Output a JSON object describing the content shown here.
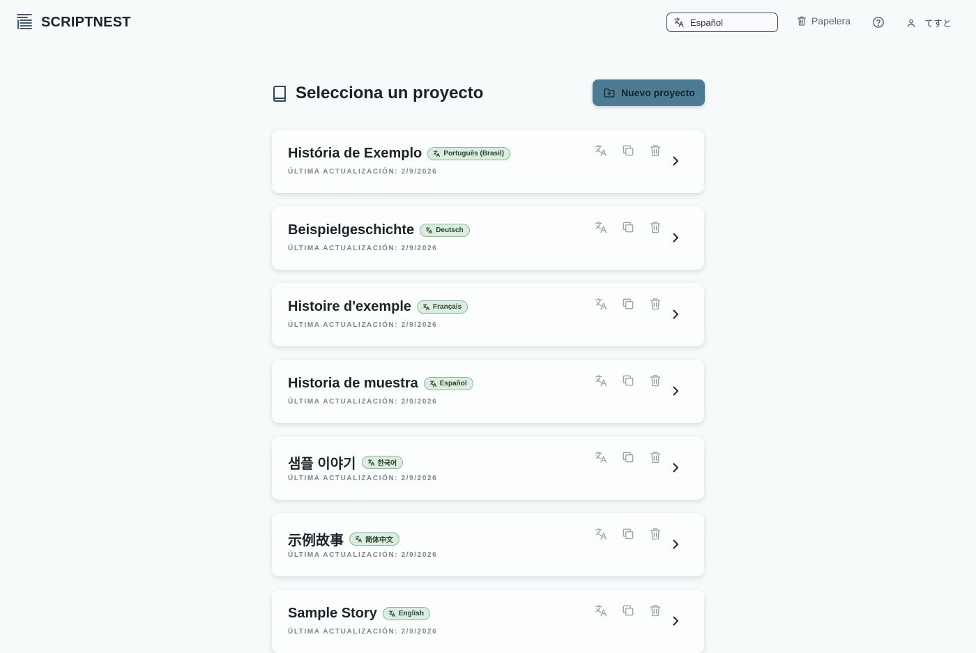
{
  "header": {
    "logo_text": "SCRIPTNEST",
    "language_value": "Español",
    "trash_label": "Papelera",
    "user_name": "てすと"
  },
  "main": {
    "title": "Selecciona un proyecto",
    "new_project_label": "Nuevo proyecto"
  },
  "projects": [
    {
      "name": "História de Exemplo",
      "language": "Português (Brasil)",
      "updated": "ÚLTIMA ACTUALIZACIÓN: 2/9/2026"
    },
    {
      "name": "Beispielgeschichte",
      "language": "Deutsch",
      "updated": "ÚLTIMA ACTUALIZACIÓN: 2/9/2026"
    },
    {
      "name": "Histoire d'exemple",
      "language": "Français",
      "updated": "ÚLTIMA ACTUALIZACIÓN: 2/9/2026"
    },
    {
      "name": "Historia de muestra",
      "language": "Español",
      "updated": "ÚLTIMA ACTUALIZACIÓN: 2/9/2026"
    },
    {
      "name": "샘플 이야기",
      "language": "한국어",
      "updated": "ÚLTIMA ACTUALIZACIÓN: 2/9/2026"
    },
    {
      "name": "示例故事",
      "language": "简体中文",
      "updated": "ÚLTIMA ACTUALIZACIÓN: 2/9/2026"
    },
    {
      "name": "Sample Story",
      "language": "English",
      "updated": "ÚLTIMA ACTUALIZACIÓN: 2/9/2026"
    }
  ],
  "icons": {
    "logo": "list-lines-icon",
    "language": "translate-icon",
    "trash": "trash-icon",
    "help": "help-circle-icon",
    "user": "user-icon",
    "book": "book-icon",
    "new_project": "folder-plus-icon",
    "duplicate": "copy-icon",
    "open": "chevron-right-icon"
  },
  "colors": {
    "primary_button": "#4c7b93",
    "badge_bg": "#dcecdf",
    "badge_border": "#8cb79a",
    "page_bg": "#f6fafb"
  }
}
